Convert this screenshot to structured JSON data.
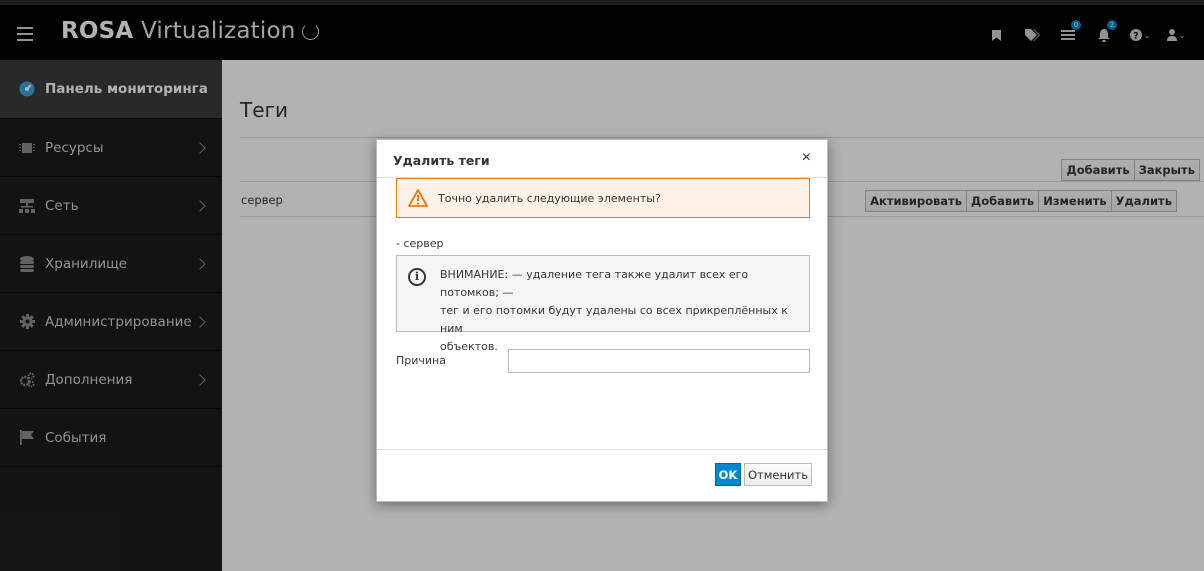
{
  "app": {
    "brand_bold": "ROSA",
    "brand_rest": " Virtualization",
    "notifications_count": "0",
    "alerts_count": "2"
  },
  "sidebar": {
    "items": [
      {
        "label": "Панель мониторинга",
        "icon": "dashboard-icon"
      },
      {
        "label": "Ресурсы",
        "icon": "chip-icon"
      },
      {
        "label": "Сеть",
        "icon": "network-icon"
      },
      {
        "label": "Хранилище",
        "icon": "database-icon"
      },
      {
        "label": "Администрирование",
        "icon": "cog-icon"
      },
      {
        "label": "Дополнения",
        "icon": "cogs-icon"
      },
      {
        "label": "События",
        "icon": "flag-icon"
      }
    ]
  },
  "page": {
    "title": "Теги",
    "top_buttons": {
      "add": "Добавить",
      "close": "Закрыть"
    },
    "row": {
      "name": "сервер",
      "buttons": {
        "activate": "Активировать",
        "add": "Добавить",
        "edit": "Изменить",
        "delete": "Удалить"
      }
    }
  },
  "modal": {
    "title": "Удалить теги",
    "close": "×",
    "warning": "Точно удалить следующие элементы?",
    "item": "- сервер",
    "info_line1": "ВНИМАНИЕ: — удаление тега также удалит всех его потомков; —",
    "info_line2": "тег и его потомки будут удалены со всех прикреплённых к ним",
    "info_line3": "объектов.",
    "reason_label": "Причина",
    "reason_value": "",
    "ok": "OK",
    "cancel": "Отменить"
  }
}
